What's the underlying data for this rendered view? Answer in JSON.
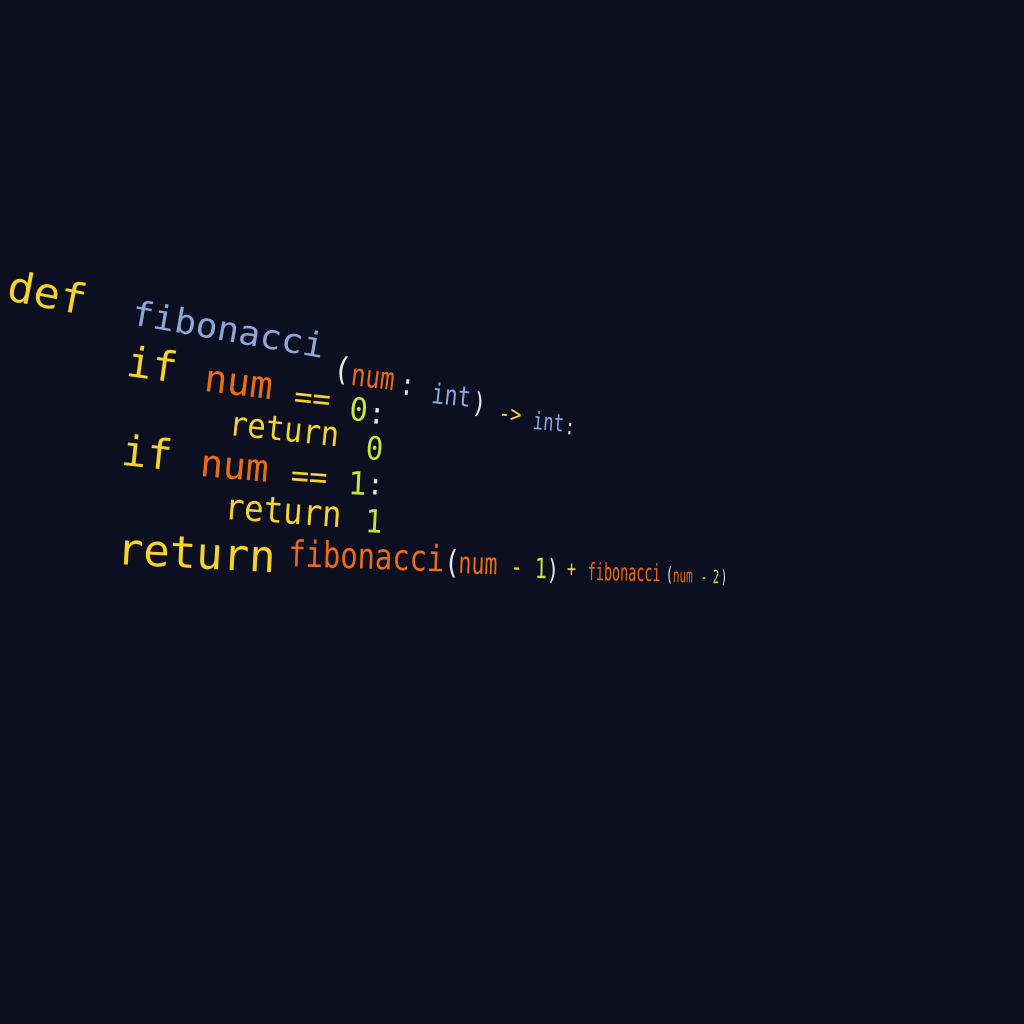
{
  "colors": {
    "background": "#0c0f1f",
    "keyword": "#f5d22c",
    "function_name": "#8fa6d8",
    "identifier": "#ee6a14",
    "number": "#c8e63a",
    "punctuation": "#e8e8ee",
    "type": "#8fa6d8"
  },
  "code": {
    "line1": {
      "def": "def",
      "name": "fibonacci",
      "open_paren": "(",
      "param": "num",
      "colon": ":",
      "type": "int",
      "close_paren": ")",
      "arrow": "->",
      "return_type": "int",
      "end_colon": ":"
    },
    "line2": {
      "if": "if",
      "var": "num",
      "op": "==",
      "value": "0",
      "colon": ":"
    },
    "line3": {
      "return": "return",
      "value": "0"
    },
    "line4": {
      "if": "if",
      "var": "num",
      "op": "==",
      "value": "1",
      "colon": ":"
    },
    "line5": {
      "return": "return",
      "value": "1"
    },
    "line6": {
      "return": "return",
      "call1": "fibonacci",
      "open1": "(",
      "var1": "num",
      "minus1": "-",
      "n1": "1",
      "close1": ")",
      "plus": "+",
      "call2": "fibonacci",
      "open2": "(",
      "var2": "num",
      "minus2": "-",
      "n2": "2",
      "close2": ")"
    }
  }
}
